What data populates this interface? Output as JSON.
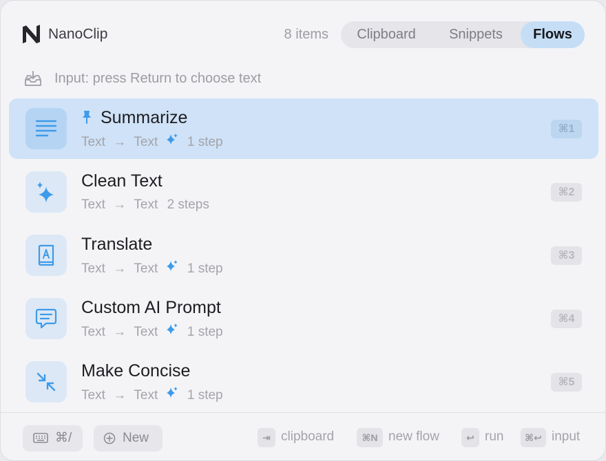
{
  "app": {
    "title": "NanoClip"
  },
  "header": {
    "count": "8 items",
    "tabs": [
      {
        "label": "Clipboard",
        "active": false
      },
      {
        "label": "Snippets",
        "active": false
      },
      {
        "label": "Flows",
        "active": true
      }
    ]
  },
  "input_hint": "Input: press Return to choose text",
  "flows": [
    {
      "title": "Summarize",
      "pinned": true,
      "selected": true,
      "from": "Text",
      "arrow": "→",
      "to": "Text",
      "ai": true,
      "steps": "1 step",
      "shortcut": "⌘1",
      "icon": "lines-icon"
    },
    {
      "title": "Clean Text",
      "pinned": false,
      "selected": false,
      "from": "Text",
      "arrow": "→",
      "to": "Text",
      "ai": false,
      "steps": "2 steps",
      "shortcut": "⌘2",
      "icon": "sparkles-icon"
    },
    {
      "title": "Translate",
      "pinned": false,
      "selected": false,
      "from": "Text",
      "arrow": "→",
      "to": "Text",
      "ai": true,
      "steps": "1 step",
      "shortcut": "⌘3",
      "icon": "dictionary-icon"
    },
    {
      "title": "Custom AI Prompt",
      "pinned": false,
      "selected": false,
      "from": "Text",
      "arrow": "→",
      "to": "Text",
      "ai": true,
      "steps": "1 step",
      "shortcut": "⌘4",
      "icon": "chat-bubble-icon"
    },
    {
      "title": "Make Concise",
      "pinned": false,
      "selected": false,
      "from": "Text",
      "arrow": "→",
      "to": "Text",
      "ai": true,
      "steps": "1 step",
      "shortcut": "⌘5",
      "icon": "compress-icon"
    }
  ],
  "footer": {
    "keyboard_label": "⌘/",
    "new_label": "New",
    "hints": [
      {
        "key": "⇥",
        "label": "clipboard"
      },
      {
        "key": "⌘N",
        "label": "new flow"
      },
      {
        "key": "↩",
        "label": "run"
      },
      {
        "key": "⌘↩",
        "label": "input"
      }
    ]
  },
  "colors": {
    "accent": "#3d9be9",
    "selected_row": "#cfe2f7",
    "active_tab": "#c5def6"
  }
}
